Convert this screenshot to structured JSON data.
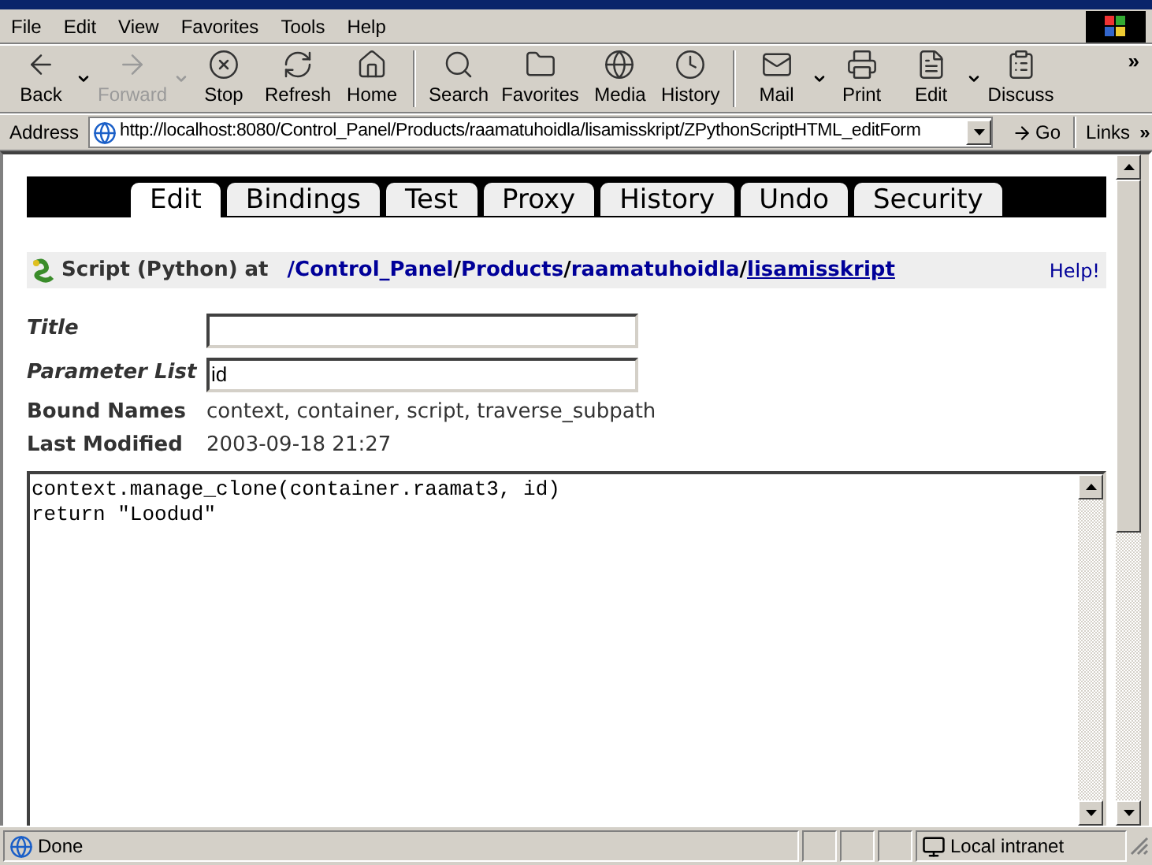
{
  "menu": [
    "File",
    "Edit",
    "View",
    "Favorites",
    "Tools",
    "Help"
  ],
  "toolbar": [
    {
      "label": "Back",
      "disabled": false,
      "dropdown": true
    },
    {
      "label": "Forward",
      "disabled": true,
      "dropdown": true
    },
    {
      "label": "Stop",
      "disabled": false,
      "dropdown": false
    },
    {
      "label": "Refresh",
      "disabled": false,
      "dropdown": false
    },
    {
      "label": "Home",
      "disabled": false,
      "dropdown": false
    },
    {
      "label": "Search",
      "disabled": false,
      "dropdown": false
    },
    {
      "label": "Favorites",
      "disabled": false,
      "dropdown": false
    },
    {
      "label": "Media",
      "disabled": false,
      "dropdown": false
    },
    {
      "label": "History",
      "disabled": false,
      "dropdown": false
    },
    {
      "label": "Mail",
      "disabled": false,
      "dropdown": true
    },
    {
      "label": "Print",
      "disabled": false,
      "dropdown": false
    },
    {
      "label": "Edit",
      "disabled": false,
      "dropdown": true
    },
    {
      "label": "Discuss",
      "disabled": false,
      "dropdown": false
    }
  ],
  "toolbar_more": "»",
  "address": {
    "label": "Address",
    "value": "http://localhost:8080/Control_Panel/Products/raamatuhoidla/lisamisskript/ZPythonScriptHTML_editForm",
    "go": "Go",
    "links": "Links",
    "links_more": "»"
  },
  "tabs": [
    {
      "label": "Edit",
      "selected": true
    },
    {
      "label": "Bindings",
      "selected": false
    },
    {
      "label": "Test",
      "selected": false
    },
    {
      "label": "Proxy",
      "selected": false
    },
    {
      "label": "History",
      "selected": false
    },
    {
      "label": "Undo",
      "selected": false
    },
    {
      "label": "Security",
      "selected": false
    }
  ],
  "header": {
    "type_label": "Script (Python) at",
    "path": [
      {
        "text": "/Control_Panel",
        "current": false
      },
      {
        "text": "Products",
        "current": false
      },
      {
        "text": "raamatuhoidla",
        "current": false
      },
      {
        "text": "lisamisskript",
        "current": true
      }
    ],
    "separator": "/",
    "help": "Help!"
  },
  "form": {
    "fields": [
      {
        "label": "Title"
      },
      {
        "label": "Parameter List",
        "value": "id"
      }
    ],
    "info": [
      {
        "label": "Bound Names",
        "value": "context, container, script, traverse_subpath"
      },
      {
        "label": "Last Modified",
        "value": "2003-09-18 21:27"
      }
    ],
    "code": "context.manage_clone(container.raamat3, id)\nreturn \"Loodud\""
  },
  "status_bar": {
    "text": "Done",
    "zone": "Local intranet"
  }
}
